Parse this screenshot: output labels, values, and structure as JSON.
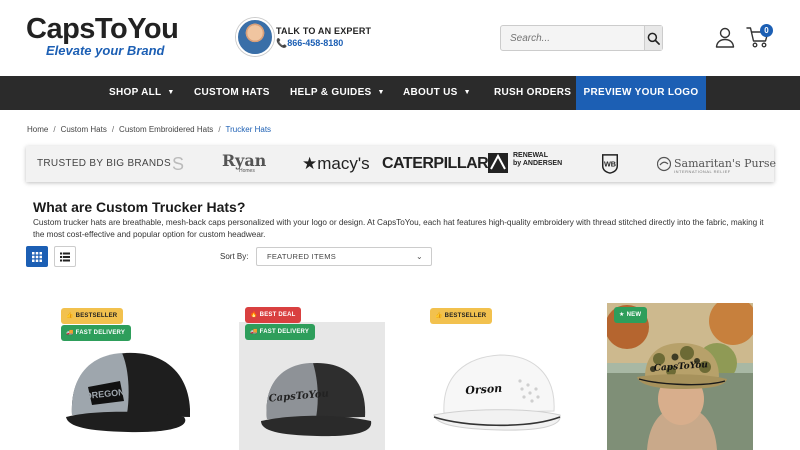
{
  "header": {
    "logo_main": "CapsToYou",
    "logo_tagline": "Elevate your Brand",
    "expert_title": "TALK TO AN EXPERT",
    "expert_phone": "866-458-8180",
    "search_placeholder": "Search...",
    "cart_count": "0"
  },
  "nav": {
    "items": [
      {
        "label": "SHOP ALL",
        "has_caret": true
      },
      {
        "label": "CUSTOM HATS",
        "has_caret": false
      },
      {
        "label": "HELP & GUIDES",
        "has_caret": true
      },
      {
        "label": "ABOUT US",
        "has_caret": true
      },
      {
        "label": "RUSH ORDERS",
        "has_caret": false
      }
    ],
    "cta": "PREVIEW YOUR LOGO"
  },
  "breadcrumb": [
    "Home",
    "Custom Hats",
    "Custom Embroidered Hats",
    "Trucker Hats"
  ],
  "brands": {
    "label": "TRUSTED BY BIG BRANDS",
    "fade_char": "S",
    "ryan": "Ryan",
    "ryan_sub": "Homes",
    "macys": "★macy's",
    "caterpillar": "CATERPILLAR",
    "renewal_line1": "RENEWAL",
    "renewal_line2": "by ANDERSEN",
    "wb": "WB",
    "samaritan": "Samaritan's Purse",
    "samaritan_sub": "INTERNATIONAL RELIEF"
  },
  "content": {
    "title": "What are Custom Trucker Hats?",
    "intro": "Custom trucker hats are breathable, mesh-back caps personalized with your logo or design. At CapsToYou, each hat features high-quality embroidery with thread stitched directly into the fabric, making it the most cost-effective and popular option for custom headwear.",
    "sort_label": "Sort By:",
    "sort_value": "FEATURED ITEMS"
  },
  "products": [
    {
      "badges": [
        "BESTSELLER",
        "FAST DELIVERY"
      ],
      "cap_text": "OREGON"
    },
    {
      "badges": [
        "BEST DEAL",
        "FAST DELIVERY"
      ],
      "cap_text": "CapsToYou"
    },
    {
      "badges": [
        "BESTSELLER"
      ],
      "cap_text": "Orson"
    },
    {
      "badges": [
        "NEW"
      ],
      "cap_text": "CapsToYou"
    }
  ],
  "colors": {
    "brand_blue": "#1c5fb4",
    "nav_bg": "#2b2b2b",
    "bestseller": "#f2c14e",
    "fast_delivery": "#2e9e5b",
    "best_deal": "#d94040"
  }
}
